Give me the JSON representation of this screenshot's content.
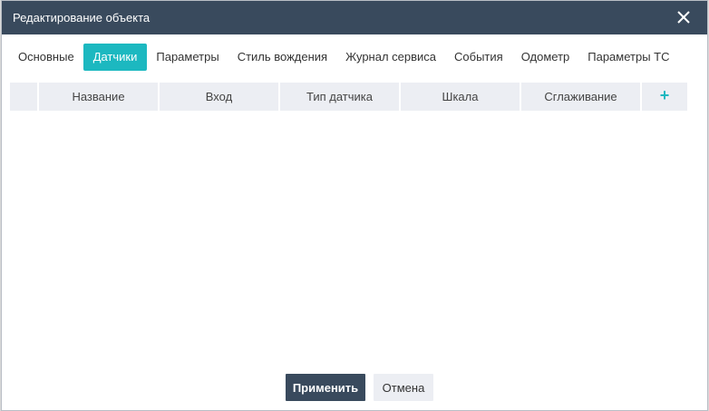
{
  "dialog": {
    "title": "Редактирование объекта"
  },
  "tabs": [
    {
      "label": "Основные",
      "active": false
    },
    {
      "label": "Датчики",
      "active": true
    },
    {
      "label": "Параметры",
      "active": false
    },
    {
      "label": "Стиль вождения",
      "active": false
    },
    {
      "label": "Журнал сервиса",
      "active": false
    },
    {
      "label": "События",
      "active": false
    },
    {
      "label": "Одометр",
      "active": false
    },
    {
      "label": "Параметры ТС",
      "active": false
    }
  ],
  "grid": {
    "columns": [
      "Название",
      "Вход",
      "Тип датчика",
      "Шкала",
      "Сглаживание"
    ],
    "add_label": "+",
    "rows": []
  },
  "footer": {
    "apply_label": "Применить",
    "cancel_label": "Отмена"
  },
  "colors": {
    "titlebar": "#394a5d",
    "accent": "#1cb8c0",
    "header_cell": "#eceef3"
  }
}
